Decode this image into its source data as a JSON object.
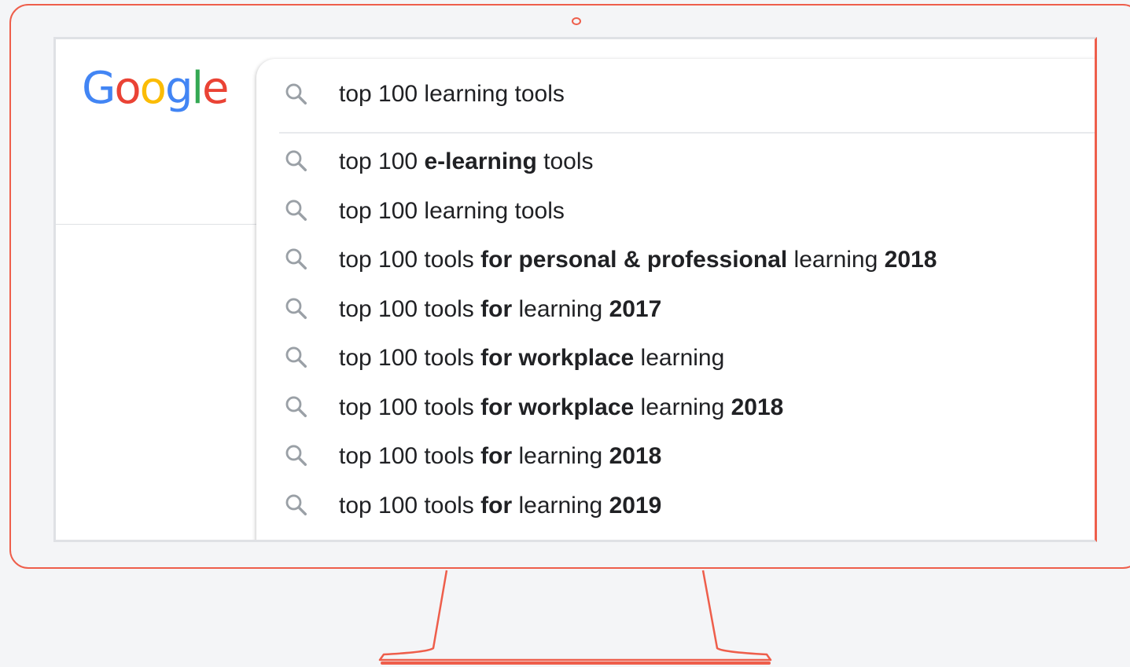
{
  "logo": {
    "letters": [
      "G",
      "o",
      "o",
      "g",
      "l",
      "e"
    ]
  },
  "search": {
    "value": "top 100 learning tools",
    "icon": "search-icon"
  },
  "suggestions": [
    {
      "parts": [
        {
          "t": "top 100 ",
          "b": false
        },
        {
          "t": "e-learning",
          "b": true
        },
        {
          "t": " tools",
          "b": false
        }
      ]
    },
    {
      "parts": [
        {
          "t": "top 100 learning tools",
          "b": false
        }
      ]
    },
    {
      "parts": [
        {
          "t": "top 100 tools ",
          "b": false
        },
        {
          "t": "for personal & professional",
          "b": true
        },
        {
          "t": " learning ",
          "b": false
        },
        {
          "t": "2018",
          "b": true
        }
      ]
    },
    {
      "parts": [
        {
          "t": "top 100 tools ",
          "b": false
        },
        {
          "t": "for",
          "b": true
        },
        {
          "t": " learning ",
          "b": false
        },
        {
          "t": "2017",
          "b": true
        }
      ]
    },
    {
      "parts": [
        {
          "t": "top 100 tools ",
          "b": false
        },
        {
          "t": "for workplace",
          "b": true
        },
        {
          "t": " learning",
          "b": false
        }
      ]
    },
    {
      "parts": [
        {
          "t": "top 100 tools ",
          "b": false
        },
        {
          "t": "for workplace",
          "b": true
        },
        {
          "t": " learning ",
          "b": false
        },
        {
          "t": "2018",
          "b": true
        }
      ]
    },
    {
      "parts": [
        {
          "t": "top 100 tools ",
          "b": false
        },
        {
          "t": "for",
          "b": true
        },
        {
          "t": " learning ",
          "b": false
        },
        {
          "t": "2018",
          "b": true
        }
      ]
    },
    {
      "parts": [
        {
          "t": "top 100 tools ",
          "b": false
        },
        {
          "t": "for",
          "b": true
        },
        {
          "t": " learning ",
          "b": false
        },
        {
          "t": "2019",
          "b": true
        }
      ]
    }
  ],
  "colors": {
    "monitor_frame": "#ee5e4b",
    "background": "#f4f5f7",
    "google_blue": "#4285f4",
    "google_red": "#ea4335",
    "google_yellow": "#fbbc05",
    "google_green": "#34a853"
  }
}
